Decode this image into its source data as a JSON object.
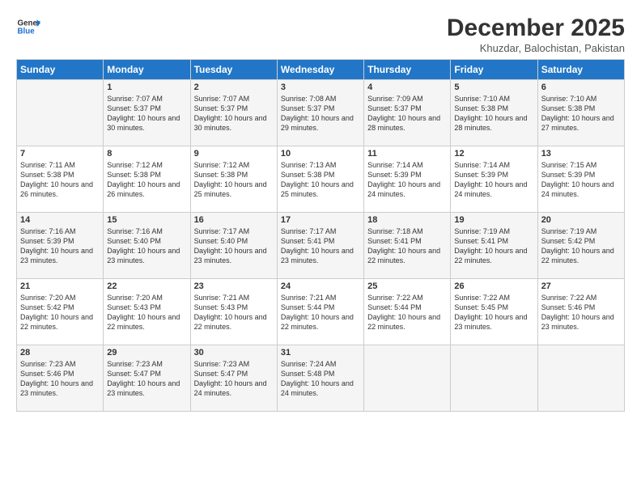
{
  "logo": {
    "line1": "General",
    "line2": "Blue"
  },
  "title": "December 2025",
  "location": "Khuzdar, Balochistan, Pakistan",
  "header_days": [
    "Sunday",
    "Monday",
    "Tuesday",
    "Wednesday",
    "Thursday",
    "Friday",
    "Saturday"
  ],
  "weeks": [
    [
      {
        "day": "",
        "sunrise": "",
        "sunset": "",
        "daylight": ""
      },
      {
        "day": "1",
        "sunrise": "Sunrise: 7:07 AM",
        "sunset": "Sunset: 5:37 PM",
        "daylight": "Daylight: 10 hours and 30 minutes."
      },
      {
        "day": "2",
        "sunrise": "Sunrise: 7:07 AM",
        "sunset": "Sunset: 5:37 PM",
        "daylight": "Daylight: 10 hours and 30 minutes."
      },
      {
        "day": "3",
        "sunrise": "Sunrise: 7:08 AM",
        "sunset": "Sunset: 5:37 PM",
        "daylight": "Daylight: 10 hours and 29 minutes."
      },
      {
        "day": "4",
        "sunrise": "Sunrise: 7:09 AM",
        "sunset": "Sunset: 5:37 PM",
        "daylight": "Daylight: 10 hours and 28 minutes."
      },
      {
        "day": "5",
        "sunrise": "Sunrise: 7:10 AM",
        "sunset": "Sunset: 5:38 PM",
        "daylight": "Daylight: 10 hours and 28 minutes."
      },
      {
        "day": "6",
        "sunrise": "Sunrise: 7:10 AM",
        "sunset": "Sunset: 5:38 PM",
        "daylight": "Daylight: 10 hours and 27 minutes."
      }
    ],
    [
      {
        "day": "7",
        "sunrise": "Sunrise: 7:11 AM",
        "sunset": "Sunset: 5:38 PM",
        "daylight": "Daylight: 10 hours and 26 minutes."
      },
      {
        "day": "8",
        "sunrise": "Sunrise: 7:12 AM",
        "sunset": "Sunset: 5:38 PM",
        "daylight": "Daylight: 10 hours and 26 minutes."
      },
      {
        "day": "9",
        "sunrise": "Sunrise: 7:12 AM",
        "sunset": "Sunset: 5:38 PM",
        "daylight": "Daylight: 10 hours and 25 minutes."
      },
      {
        "day": "10",
        "sunrise": "Sunrise: 7:13 AM",
        "sunset": "Sunset: 5:38 PM",
        "daylight": "Daylight: 10 hours and 25 minutes."
      },
      {
        "day": "11",
        "sunrise": "Sunrise: 7:14 AM",
        "sunset": "Sunset: 5:39 PM",
        "daylight": "Daylight: 10 hours and 24 minutes."
      },
      {
        "day": "12",
        "sunrise": "Sunrise: 7:14 AM",
        "sunset": "Sunset: 5:39 PM",
        "daylight": "Daylight: 10 hours and 24 minutes."
      },
      {
        "day": "13",
        "sunrise": "Sunrise: 7:15 AM",
        "sunset": "Sunset: 5:39 PM",
        "daylight": "Daylight: 10 hours and 24 minutes."
      }
    ],
    [
      {
        "day": "14",
        "sunrise": "Sunrise: 7:16 AM",
        "sunset": "Sunset: 5:39 PM",
        "daylight": "Daylight: 10 hours and 23 minutes."
      },
      {
        "day": "15",
        "sunrise": "Sunrise: 7:16 AM",
        "sunset": "Sunset: 5:40 PM",
        "daylight": "Daylight: 10 hours and 23 minutes."
      },
      {
        "day": "16",
        "sunrise": "Sunrise: 7:17 AM",
        "sunset": "Sunset: 5:40 PM",
        "daylight": "Daylight: 10 hours and 23 minutes."
      },
      {
        "day": "17",
        "sunrise": "Sunrise: 7:17 AM",
        "sunset": "Sunset: 5:41 PM",
        "daylight": "Daylight: 10 hours and 23 minutes."
      },
      {
        "day": "18",
        "sunrise": "Sunrise: 7:18 AM",
        "sunset": "Sunset: 5:41 PM",
        "daylight": "Daylight: 10 hours and 22 minutes."
      },
      {
        "day": "19",
        "sunrise": "Sunrise: 7:19 AM",
        "sunset": "Sunset: 5:41 PM",
        "daylight": "Daylight: 10 hours and 22 minutes."
      },
      {
        "day": "20",
        "sunrise": "Sunrise: 7:19 AM",
        "sunset": "Sunset: 5:42 PM",
        "daylight": "Daylight: 10 hours and 22 minutes."
      }
    ],
    [
      {
        "day": "21",
        "sunrise": "Sunrise: 7:20 AM",
        "sunset": "Sunset: 5:42 PM",
        "daylight": "Daylight: 10 hours and 22 minutes."
      },
      {
        "day": "22",
        "sunrise": "Sunrise: 7:20 AM",
        "sunset": "Sunset: 5:43 PM",
        "daylight": "Daylight: 10 hours and 22 minutes."
      },
      {
        "day": "23",
        "sunrise": "Sunrise: 7:21 AM",
        "sunset": "Sunset: 5:43 PM",
        "daylight": "Daylight: 10 hours and 22 minutes."
      },
      {
        "day": "24",
        "sunrise": "Sunrise: 7:21 AM",
        "sunset": "Sunset: 5:44 PM",
        "daylight": "Daylight: 10 hours and 22 minutes."
      },
      {
        "day": "25",
        "sunrise": "Sunrise: 7:22 AM",
        "sunset": "Sunset: 5:44 PM",
        "daylight": "Daylight: 10 hours and 22 minutes."
      },
      {
        "day": "26",
        "sunrise": "Sunrise: 7:22 AM",
        "sunset": "Sunset: 5:45 PM",
        "daylight": "Daylight: 10 hours and 23 minutes."
      },
      {
        "day": "27",
        "sunrise": "Sunrise: 7:22 AM",
        "sunset": "Sunset: 5:46 PM",
        "daylight": "Daylight: 10 hours and 23 minutes."
      }
    ],
    [
      {
        "day": "28",
        "sunrise": "Sunrise: 7:23 AM",
        "sunset": "Sunset: 5:46 PM",
        "daylight": "Daylight: 10 hours and 23 minutes."
      },
      {
        "day": "29",
        "sunrise": "Sunrise: 7:23 AM",
        "sunset": "Sunset: 5:47 PM",
        "daylight": "Daylight: 10 hours and 23 minutes."
      },
      {
        "day": "30",
        "sunrise": "Sunrise: 7:23 AM",
        "sunset": "Sunset: 5:47 PM",
        "daylight": "Daylight: 10 hours and 24 minutes."
      },
      {
        "day": "31",
        "sunrise": "Sunrise: 7:24 AM",
        "sunset": "Sunset: 5:48 PM",
        "daylight": "Daylight: 10 hours and 24 minutes."
      },
      {
        "day": "",
        "sunrise": "",
        "sunset": "",
        "daylight": ""
      },
      {
        "day": "",
        "sunrise": "",
        "sunset": "",
        "daylight": ""
      },
      {
        "day": "",
        "sunrise": "",
        "sunset": "",
        "daylight": ""
      }
    ]
  ]
}
